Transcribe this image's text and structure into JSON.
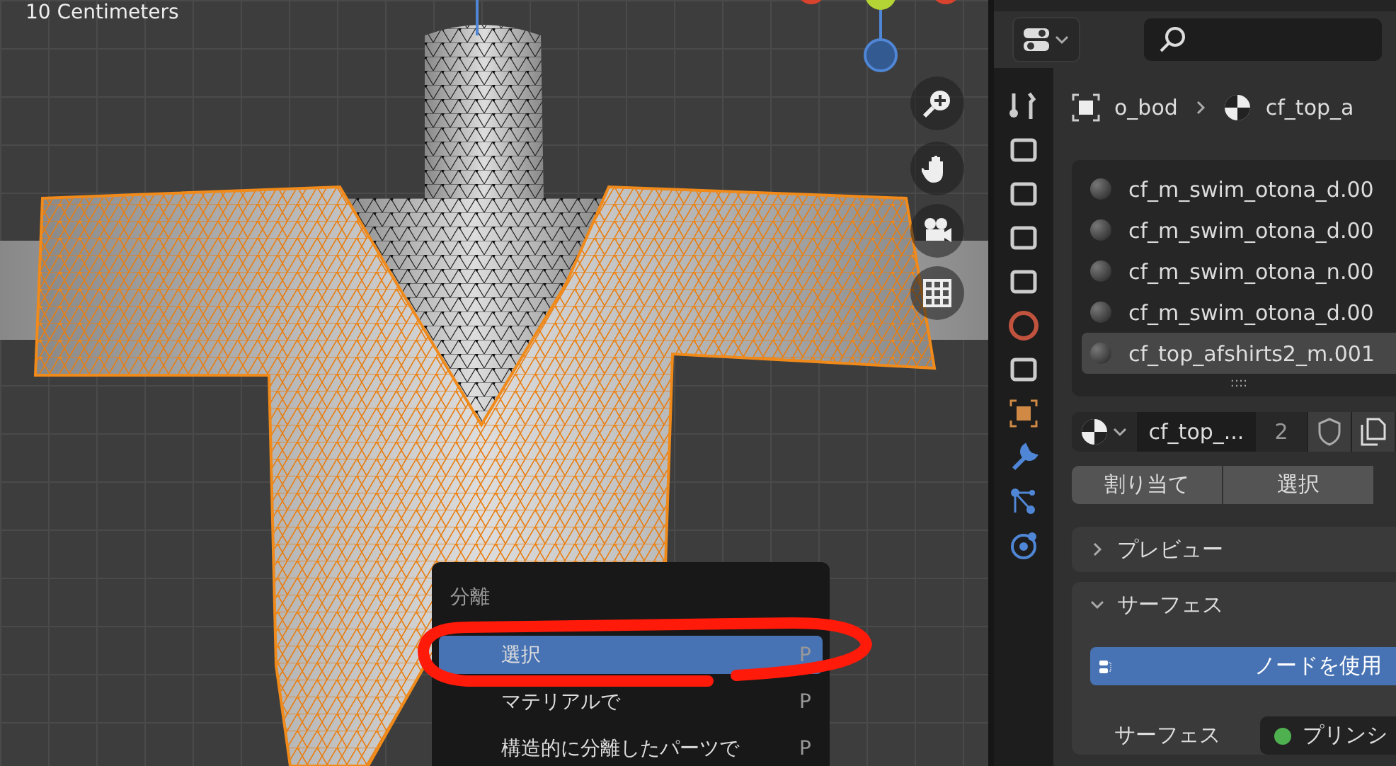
{
  "viewport": {
    "scale_label": "10 Centimeters"
  },
  "context_menu": {
    "title": "分離",
    "items": [
      {
        "label": "選択",
        "shortcut": "P",
        "selected": true
      },
      {
        "label": "マテリアルで",
        "shortcut": "P",
        "selected": false
      },
      {
        "label": "構造的に分離したパーツで",
        "shortcut": "P",
        "selected": false
      }
    ]
  },
  "properties": {
    "breadcrumb": [
      "o_bod",
      "cf_top_a"
    ],
    "material_slots": [
      {
        "name": "cf_m_swim_otona_d.00",
        "selected": false
      },
      {
        "name": "cf_m_swim_otona_d.00",
        "selected": false
      },
      {
        "name": "cf_m_swim_otona_n.00",
        "selected": false
      },
      {
        "name": "cf_m_swim_otona_d.00",
        "selected": false
      },
      {
        "name": "cf_top_afshirts2_m.001",
        "selected": true
      }
    ],
    "list_grip": "::::",
    "material_name": "cf_top_...",
    "users": "2",
    "buttons": [
      "割り当て",
      "選択"
    ],
    "panels": [
      {
        "title": "プレビュー",
        "expanded": false
      },
      {
        "title": "サーフェス",
        "expanded": true
      }
    ],
    "use_nodes": "ノードを使用",
    "surface_label": "サーフェス",
    "surface_value": "プリンシ"
  }
}
